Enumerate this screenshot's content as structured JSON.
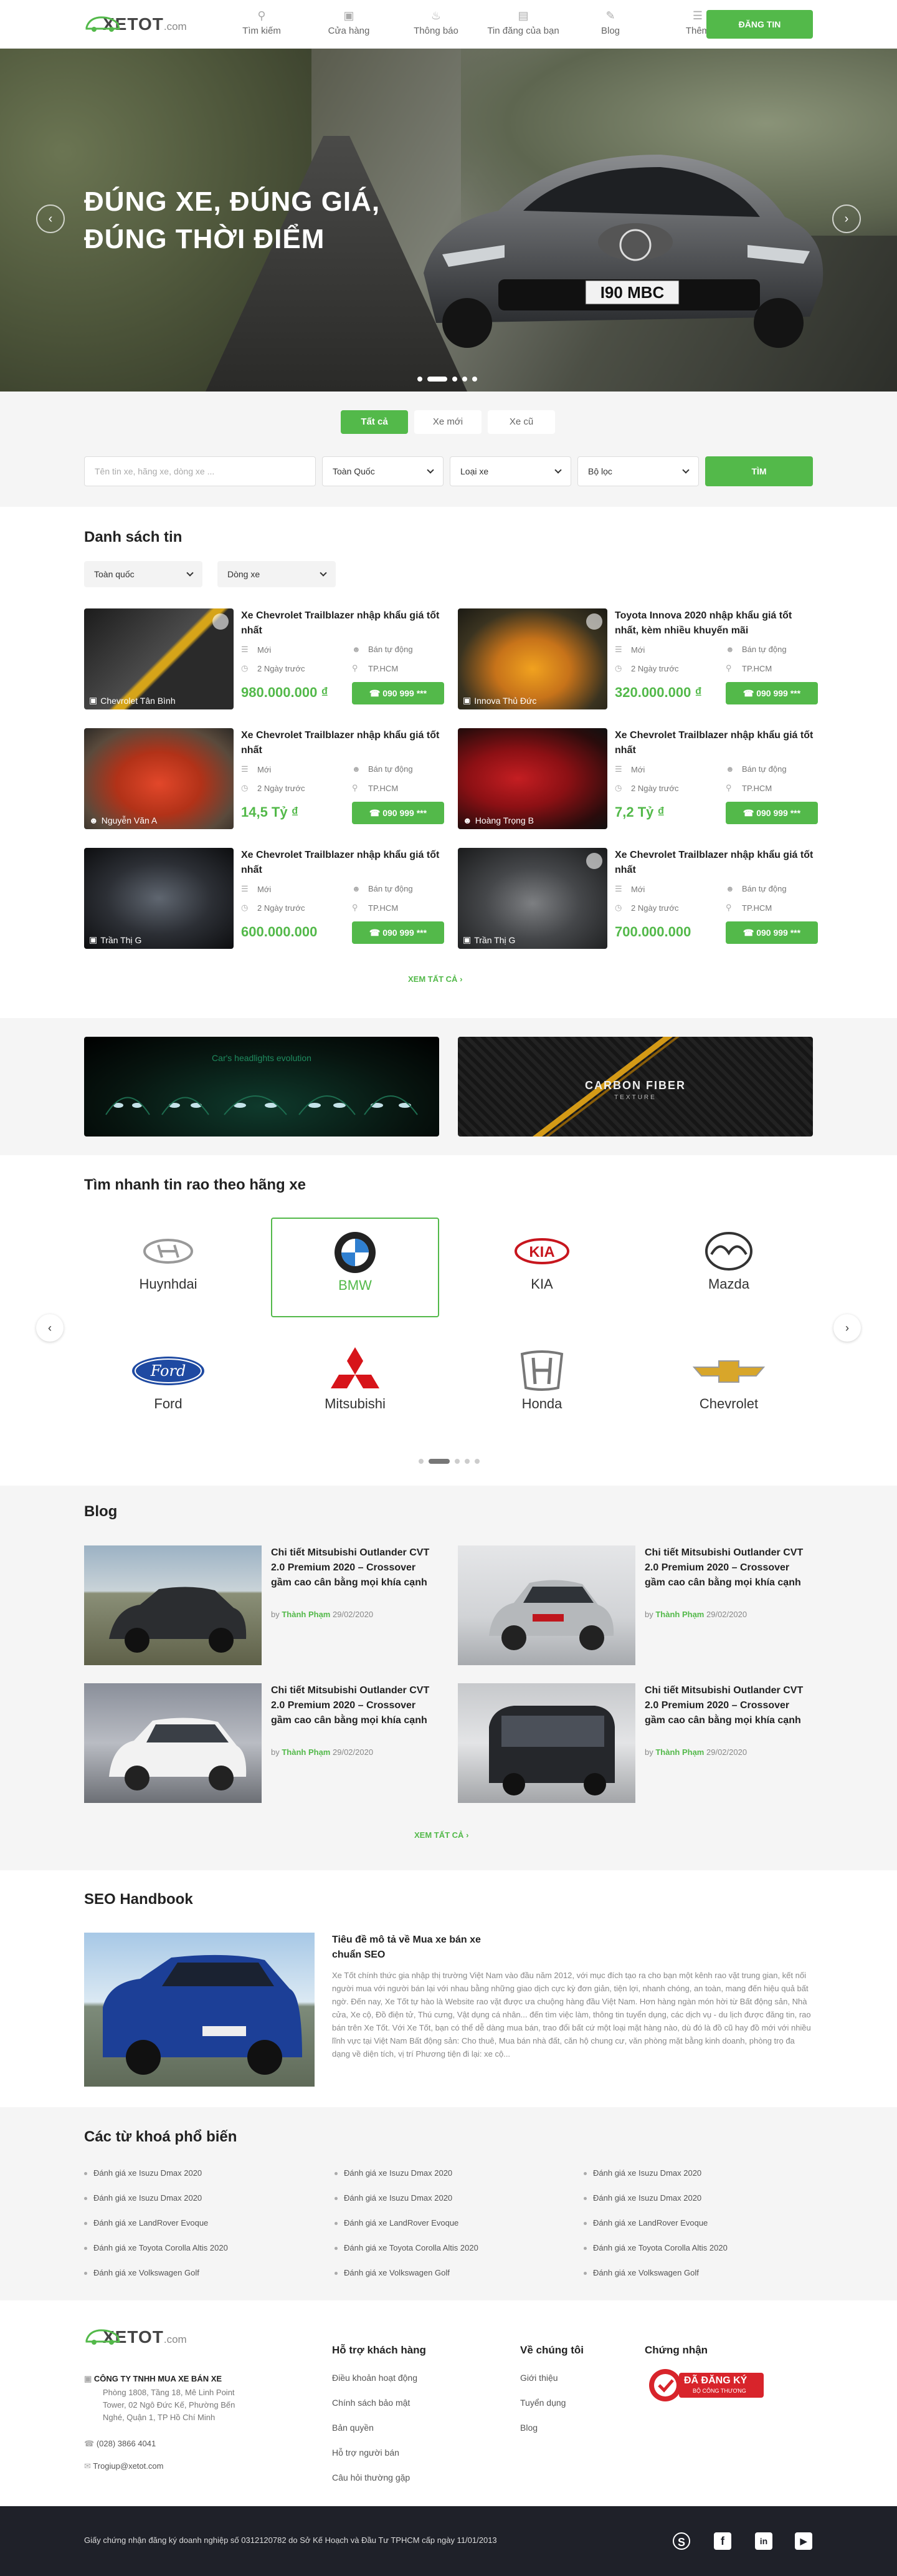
{
  "header": {
    "logo_text": "XETOT",
    "logo_suffix": ".com",
    "nav": [
      {
        "label": "Tìm kiếm",
        "icon": "search-icon"
      },
      {
        "label": "Cửa hàng",
        "icon": "store-icon"
      },
      {
        "label": "Thông báo",
        "icon": "bell-icon"
      },
      {
        "label": "Tin đăng của bạn",
        "icon": "list-icon"
      },
      {
        "label": "Blog",
        "icon": "blog-icon"
      },
      {
        "label": "Thêm",
        "icon": "more-icon"
      }
    ],
    "post_button": "ĐĂNG TIN"
  },
  "hero": {
    "line1": "ĐÚNG XE, ĐÚNG GIÁ,",
    "line2": "ĐÚNG THỜI ĐIỂM",
    "plate": "I90 MBC"
  },
  "search": {
    "tabs": [
      "Tất cả",
      "Xe mới",
      "Xe cũ"
    ],
    "active_tab": "Tất cả",
    "keyword_placeholder": "Tên tin xe, hãng xe, dòng xe ...",
    "region": "Toàn Quốc",
    "car_type": "Loại xe",
    "filter": "Bộ lọc",
    "submit": "TÌM"
  },
  "listing": {
    "title": "Danh sách tin",
    "filter_region": "Toàn quốc",
    "filter_model": "Dòng xe",
    "cards": [
      {
        "title": "Xe Chevrolet Trailblazer nhập khẩu giá tốt nhất",
        "seller": "Chevrolet Tân Bình",
        "condition": "Mới",
        "time": "2 Ngày trước",
        "status": "Bán tự động",
        "location": "TP.HCM",
        "price": "980.000.000 ₫",
        "phone": "090 999 ***"
      },
      {
        "title": "Toyota Innova 2020 nhập khẩu giá tốt nhất, kèm nhiều khuyến mãi",
        "seller": "Innova Thủ Đức",
        "condition": "Mới",
        "time": "2 Ngày trước",
        "status": "Bán tự động",
        "location": "TP.HCM",
        "price": "320.000.000 ₫",
        "phone": "090 999 ***"
      },
      {
        "title": "Xe Chevrolet Trailblazer nhập khẩu giá tốt nhất",
        "seller": "Nguyễn Văn A",
        "condition": "Mới",
        "time": "2 Ngày trước",
        "status": "Bán tự động",
        "location": "TP.HCM",
        "price": "14,5 Tỷ ₫",
        "phone": "090 999 ***"
      },
      {
        "title": "Xe Chevrolet Trailblazer nhập khẩu giá tốt nhất",
        "seller": "Hoàng Trọng B",
        "condition": "Mới",
        "time": "2 Ngày trước",
        "status": "Bán tự động",
        "location": "TP.HCM",
        "price": "7,2 Tỷ ₫",
        "phone": "090 999 ***"
      },
      {
        "title": "Xe Chevrolet Trailblazer nhập khẩu giá tốt nhất",
        "seller": "Trần Thị G",
        "condition": "Mới",
        "time": "2 Ngày trước",
        "status": "Bán tự động",
        "location": "TP.HCM",
        "price": "600.000.000",
        "phone": "090 999 ***"
      },
      {
        "title": "Xe Chevrolet Trailblazer nhập khẩu giá tốt nhất",
        "seller": "Trần Thị G",
        "condition": "Mới",
        "time": "2 Ngày trước",
        "status": "Bán tự động",
        "location": "TP.HCM",
        "price": "700.000.000",
        "phone": "090 999 ***"
      }
    ],
    "see_all": "XEM TẤT CẢ"
  },
  "ads": {
    "left_text": "Car's headlights evolution",
    "right_text": "CARBON FIBER",
    "right_sub": "TEXTURE"
  },
  "brands": {
    "title": "Tìm nhanh tin rao theo hãng xe",
    "items": [
      "Huynhdai",
      "BMW",
      "KIA",
      "Mazda",
      "Ford",
      "Mitsubishi",
      "Honda",
      "Chevrolet"
    ],
    "active": "BMW"
  },
  "blog": {
    "title": "Blog",
    "posts": [
      {
        "title": "Chi tiết Mitsubishi Outlander CVT 2.0 Premium 2020 – Crossover gầm cao cân bằng mọi khía cạnh",
        "by": "by",
        "author": "Thành Phạm",
        "date": "29/02/2020"
      },
      {
        "title": "Chi tiết Mitsubishi Outlander CVT 2.0 Premium 2020 – Crossover gầm cao cân bằng mọi khía cạnh",
        "by": "by",
        "author": "Thành Phạm",
        "date": "29/02/2020"
      },
      {
        "title": "Chi tiết Mitsubishi Outlander CVT 2.0 Premium 2020 – Crossover gầm cao cân bằng mọi khía cạnh",
        "by": "by",
        "author": "Thành Phạm",
        "date": "29/02/2020"
      },
      {
        "title": "Chi tiết Mitsubishi Outlander CVT 2.0 Premium 2020 – Crossover gầm cao cân bằng mọi khía cạnh",
        "by": "by",
        "author": "Thành Phạm",
        "date": "29/02/2020"
      }
    ],
    "see_all": "XEM TẤT CẢ"
  },
  "seo": {
    "title": "SEO Handbook",
    "article_title": "Tiêu đề mô tả về  Mua xe bán xe chuẩn SEO",
    "article_body": "Xe Tốt chính thức gia nhập thị trường Việt Nam vào đầu năm 2012, với mục đích tạo ra cho bạn một kênh rao vặt trung gian, kết nối người mua với người bán lại với nhau bằng những giao dịch cực kỳ đơn giản, tiện lợi, nhanh chóng, an toàn, mang đến hiệu quả bất ngờ. Đến nay, Xe Tốt tự hào là Website rao vặt được ưa chuộng hàng đầu Việt Nam. Hơn hàng ngàn món hời từ Bất động sản, Nhà cửa, Xe cộ, Đồ điện tử, Thú cưng, Vật dụng cá nhân... đến tìm việc làm, thông tin tuyển dụng, các dịch vụ - du lịch được đăng tin, rao bán trên Xe Tốt. Với Xe Tốt, bạn có thể dễ dàng mua bán, trao đổi bất cứ một loại mặt hàng nào, dù đó là đồ cũ hay đồ mới với nhiều lĩnh vực tại Việt Nam Bất động sản: Cho thuê, Mua bán nhà đất, căn hộ chung cư, văn phòng mặt bằng kinh doanh, phòng trọ đa dạng về diện tích, vị trí Phương tiện đi lại: xe cộ..."
  },
  "keywords": {
    "title": "Các từ khoá phổ biến",
    "col1": [
      "Đánh giá xe Isuzu Dmax 2020",
      "Đánh giá xe Isuzu Dmax 2020",
      "Đánh giá xe LandRover Evoque",
      "Đánh giá xe Toyota Corolla Altis 2020",
      "Đánh giá xe Volkswagen Golf"
    ],
    "col2": [
      "Đánh giá xe Isuzu Dmax 2020",
      "Đánh giá xe Isuzu Dmax 2020",
      "Đánh giá xe LandRover Evoque",
      "Đánh giá xe Toyota Corolla Altis 2020",
      "Đánh giá xe Volkswagen Golf"
    ],
    "col3": [
      "Đánh giá xe Isuzu Dmax 2020",
      "Đánh giá xe Isuzu Dmax 2020",
      "Đánh giá xe LandRover Evoque",
      "Đánh giá xe Toyota Corolla Altis 2020",
      "Đánh giá xe Volkswagen Golf"
    ]
  },
  "footer": {
    "company": "CÔNG TY TNHH MUA XE BÁN XE",
    "address": "Phòng 1808, Tầng 18, Mê Linh Point Tower, 02 Ngô Đức Kế, Phường Bến Nghé, Quận 1, TP Hồ Chí Minh",
    "phone": "(028) 3866 4041",
    "email": "Trogiup@xetot.com",
    "support_title": "Hỗ trợ khách hàng",
    "support": [
      "Điều khoản hoạt động",
      "Chính sách bảo mật",
      "Bản quyền",
      "Hỗ trợ người bán",
      "Câu hỏi thường gặp"
    ],
    "about_title": "Về chúng tôi",
    "about": [
      "Giới thiệu",
      "Tuyển dụng",
      "Blog"
    ],
    "cert_title": "Chứng nhận",
    "cert_text": "ĐÃ ĐĂNG KÝ",
    "cert_sub": "BỘ CÔNG THƯƠNG",
    "copyright": "Giấy chứng nhận đăng ký doanh nghiệp số 0312120782 do Sở Kế Hoạch và Đầu Tư TPHCM cấp ngày 11/01/2013",
    "social": [
      "S",
      "f",
      "in",
      "▶"
    ]
  }
}
